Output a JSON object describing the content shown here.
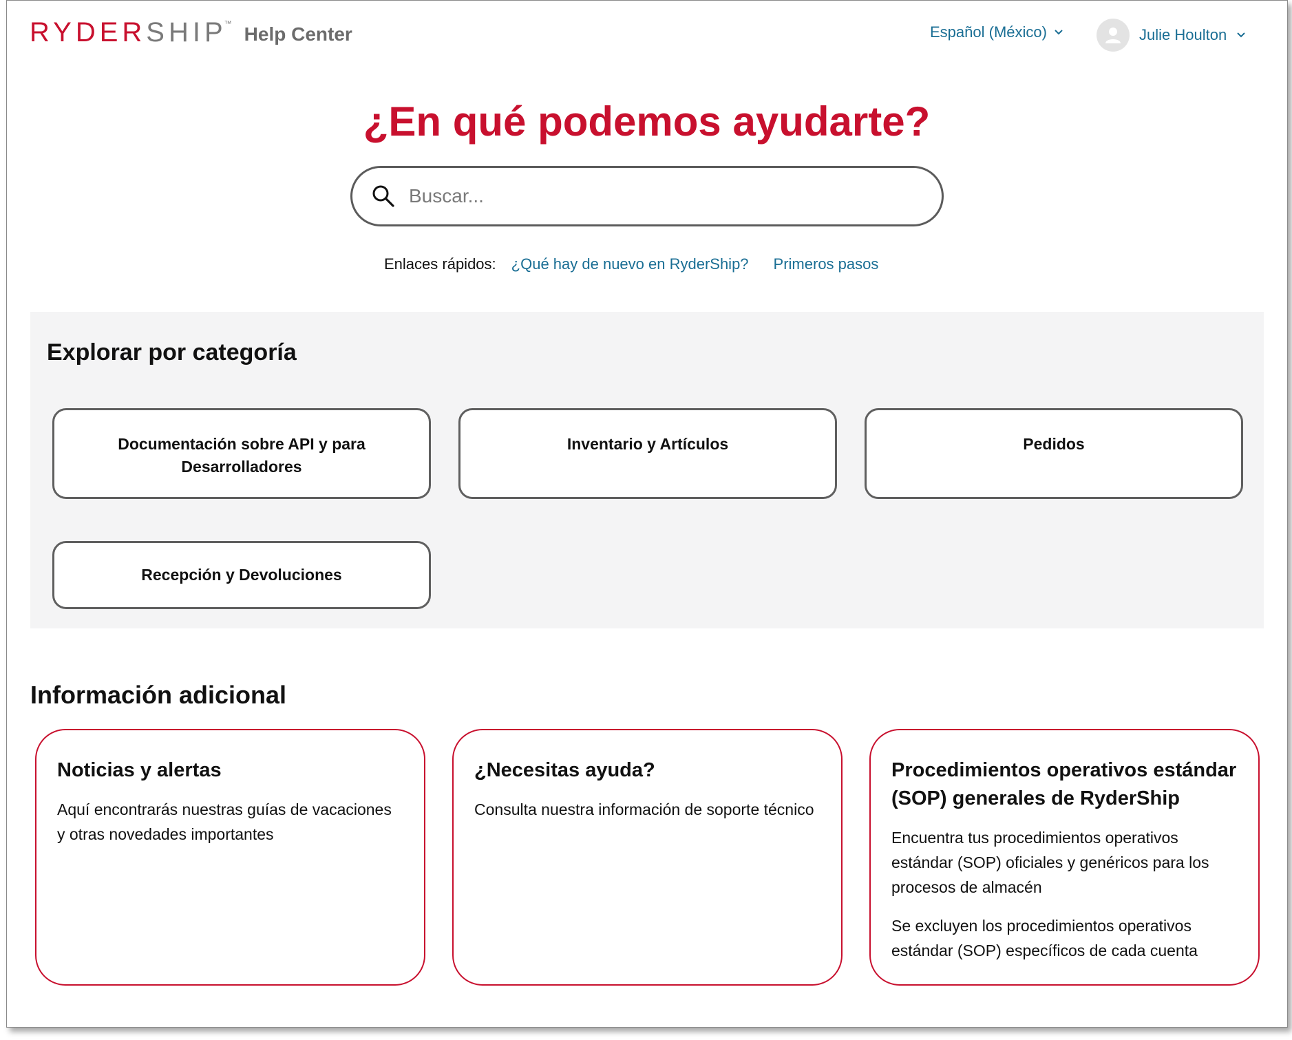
{
  "header": {
    "logo_ryder": "RYDER",
    "logo_ship": "SHIP",
    "logo_tm": "™",
    "logo_subtitle": "Help Center",
    "language": "Español (México)",
    "user_name": "Julie Houlton"
  },
  "hero": {
    "title": "¿En qué podemos ayudarte?",
    "search_placeholder": "Buscar..."
  },
  "quick_links": {
    "label": "Enlaces rápidos:",
    "links": [
      "¿Qué hay de nuevo en RyderShip?",
      "Primeros pasos"
    ]
  },
  "categories": {
    "title": "Explorar por categoría",
    "items": [
      {
        "line1": "Documentación sobre API y para",
        "line2": "Desarrolladores"
      },
      {
        "line1": "Inventario y Artículos",
        "line2": ""
      },
      {
        "line1": "Pedidos",
        "line2": ""
      },
      {
        "line1": "Recepción y Devoluciones",
        "line2": ""
      }
    ]
  },
  "additional": {
    "title": "Información adicional",
    "cards": [
      {
        "title": "Noticias y alertas",
        "paragraphs": [
          "Aquí encontrarás nuestras guías de vacaciones y otras novedades importantes"
        ]
      },
      {
        "title": "¿Necesitas ayuda?",
        "paragraphs": [
          "Consulta nuestra información de soporte técnico"
        ]
      },
      {
        "title": "Procedimientos operativos estándar (SOP) generales de RyderShip",
        "paragraphs": [
          "Encuentra tus procedimientos operativos estándar (SOP) oficiales y genéricos para los procesos de almacén",
          "Se excluyen los procedimientos operativos estándar (SOP) específicos de cada cuenta"
        ]
      }
    ]
  },
  "colors": {
    "brand_red": "#c8102e",
    "link_blue": "#1a6e94",
    "panel_gray": "#f4f4f5"
  },
  "icons": [
    "chevron-down-icon",
    "user-avatar-icon",
    "search-icon"
  ]
}
